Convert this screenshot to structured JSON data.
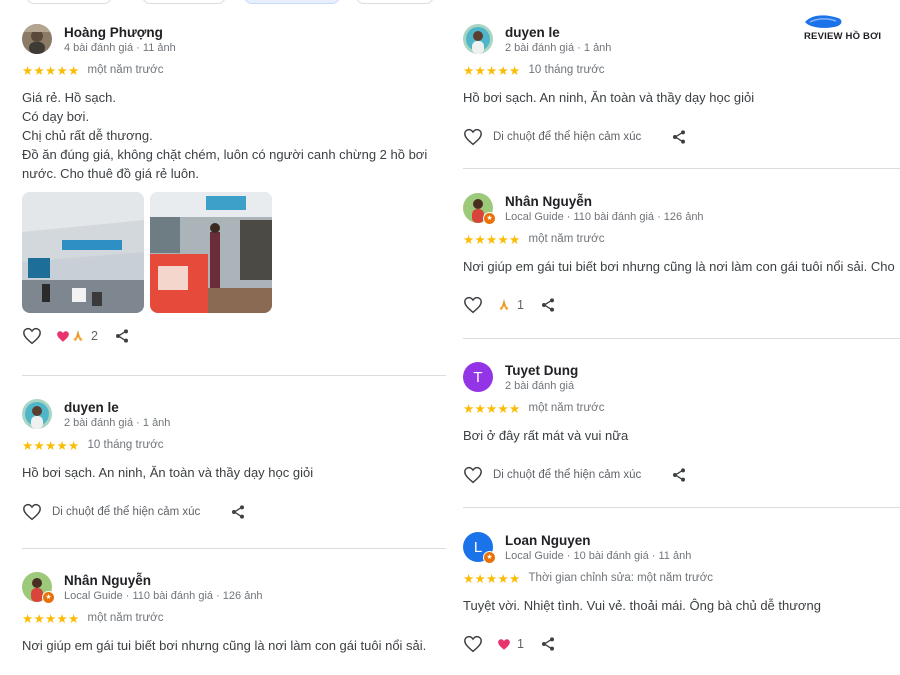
{
  "top_chips": [
    "",
    "",
    "",
    ""
  ],
  "logo": {
    "text": "REVIEW HỒ BƠI",
    "color": "#1a73e8"
  },
  "reaction_hint": "Di chuột để thể hiện cảm xúc",
  "stars": "★★★★★",
  "colors": {
    "star": "#fbbc04",
    "heart": "#e8336d",
    "purple_avatar": "#9334e6",
    "blue_avatar": "#1a73e8"
  },
  "left": [
    {
      "name": "Hoàng Phượng",
      "meta": "4 bài đánh giá · 11 ảnh",
      "time": "một năm trước",
      "lines": [
        "Giá rẻ. Hồ sạch.",
        "Có dạy bơi.",
        "Chị chủ rất dễ thương.",
        "Đồ ăn đúng giá, không chặt chém, luôn có người canh chừng 2 hồ bơi",
        "nước. Cho thuê đồ giá rẻ luôn."
      ],
      "photos": [
        "pool-hall-photo",
        "snack-counter-photo"
      ],
      "reactions": {
        "icons": [
          "heart-icon",
          "pray-icon"
        ],
        "count": "2"
      }
    },
    {
      "name": "duyen le",
      "meta": "2 bài đánh giá · 1 ảnh",
      "time": "10 tháng trước",
      "lines": [
        "Hồ bơi sạch. An ninh, Ăn toàn và thầy dạy học giỏi"
      ],
      "reactions": null
    },
    {
      "name": "Nhân Nguyễn",
      "meta": "Local Guide · 110 bài đánh giá · 126 ảnh",
      "time": "một năm trước",
      "lines": [
        "Nơi giúp em gái tui biết bơi nhưng cũng là nơi làm con gái tuôi nổi sải."
      ],
      "reactions": null
    }
  ],
  "right": [
    {
      "name": "duyen le",
      "meta": "2 bài đánh giá · 1 ảnh",
      "time": "10 tháng trước",
      "lines": [
        "Hồ bơi sạch. An ninh, Ăn toàn và thầy dạy học giỏi"
      ],
      "reactions": null
    },
    {
      "name": "Nhân Nguyễn",
      "meta": "Local Guide · 110 bài đánh giá · 126 ảnh",
      "time": "một năm trước",
      "lines": [
        "Nơi giúp em gái tui biết bơi nhưng cũng là nơi làm con gái tuôi nổi sải. Cho"
      ],
      "reactions": {
        "icons": [
          "pray-icon"
        ],
        "count": "1"
      }
    },
    {
      "name": "Tuyet Dung",
      "avatar_letter": "T",
      "meta": "2 bài đánh giá",
      "time": "một năm trước",
      "lines": [
        "Bơi ở đây rất mát và vui nữa"
      ],
      "reactions": null
    },
    {
      "name": "Loan Nguyen",
      "avatar_letter": "L",
      "meta": "Local Guide · 10 bài đánh giá · 11 ảnh",
      "time": "Thời gian chỉnh sửa: một năm trước",
      "lines": [
        "Tuyệt vời. Nhiệt tình. Vui vẻ. thoải mái. Ông bà chủ dễ thương"
      ],
      "reactions": {
        "icons": [
          "heart-icon"
        ],
        "count": "1"
      }
    }
  ]
}
